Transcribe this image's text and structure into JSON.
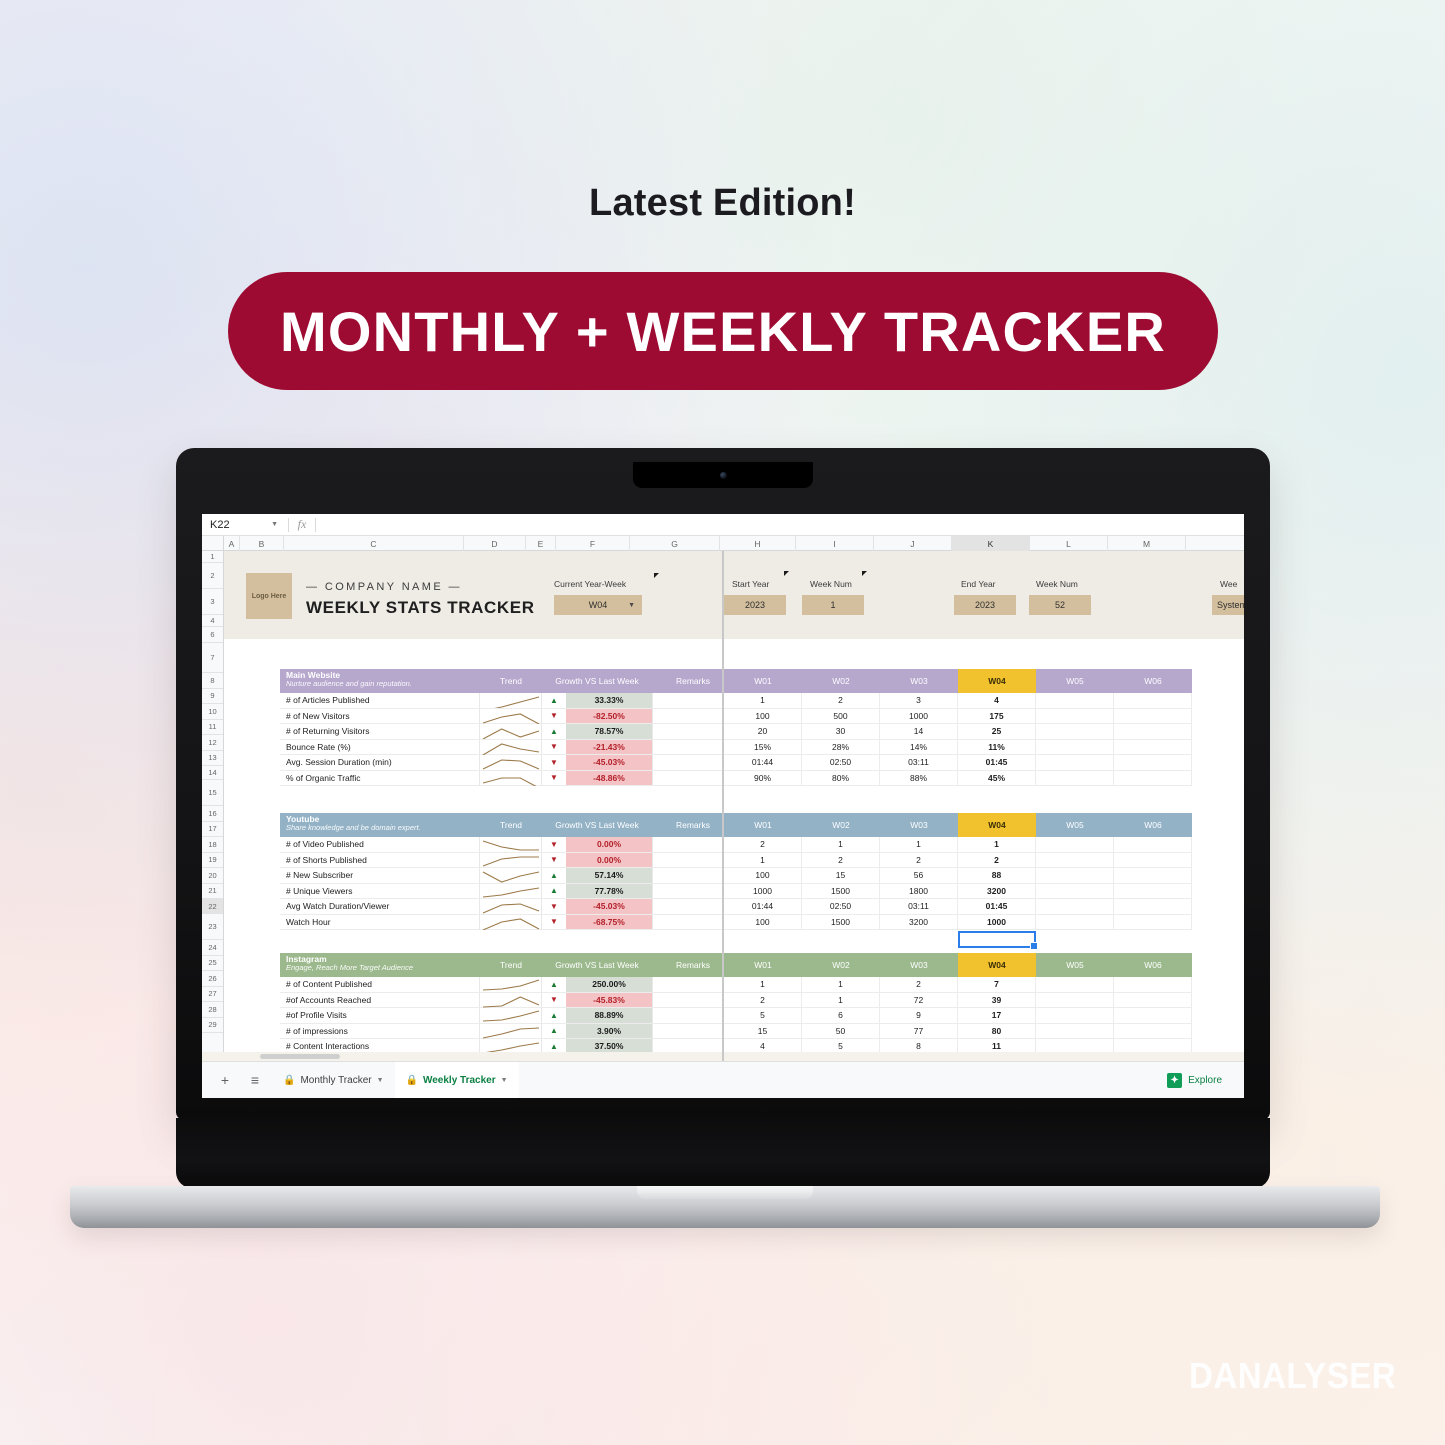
{
  "promo": {
    "eyebrow": "Latest Edition!",
    "pill_label": "MONTHLY + WEEKLY TRACKER",
    "pill_color": "#9e0b32",
    "watermark": "DANALYSER"
  },
  "spreadsheet": {
    "name_box": "K22",
    "fx_icon": "function-icon",
    "column_headers": [
      "A",
      "B",
      "C",
      "D",
      "E",
      "F",
      "G",
      "H",
      "I",
      "J",
      "K",
      "L",
      "M"
    ],
    "selected_column": "K",
    "row_headers": [
      "1",
      "2",
      "3",
      "4",
      "6",
      "7",
      "8",
      "9",
      "10",
      "11",
      "12",
      "13",
      "14",
      "15",
      "16",
      "17",
      "18",
      "19",
      "20",
      "21",
      "22",
      "23",
      "24",
      "25",
      "26",
      "27",
      "28",
      "29"
    ],
    "selected_row": "22",
    "banner": {
      "logo_text": "Logo Here",
      "company_name": "— COMPANY NAME —",
      "title": "WEEKLY STATS TRACKER",
      "fields": [
        {
          "label": "Current Year-Week",
          "value": "W04",
          "dropdown": true
        },
        {
          "label": "Start Year",
          "value": "2023",
          "dropdown": false
        },
        {
          "label": "Week Num",
          "value": "1",
          "dropdown": false
        },
        {
          "label": "End Year",
          "value": "2023",
          "dropdown": false
        },
        {
          "label": "Week Num",
          "value": "52",
          "dropdown": false
        },
        {
          "label": "Wee",
          "value": "System",
          "dropdown": false
        }
      ]
    },
    "table_headers": {
      "trend": "Trend",
      "growth": "Growth VS Last Week",
      "remarks": "Remarks"
    },
    "week_columns": [
      "W01",
      "W02",
      "W03",
      "W04",
      "W05",
      "W06"
    ],
    "current_week": "W04",
    "current_week_color": "#f2c12e",
    "sections": [
      {
        "id": "main-website",
        "icon": "website-icon",
        "name": "Main Website",
        "tagline": "Nurture audience and gain reputation.",
        "color": "#b6a7cd",
        "rows": [
          {
            "metric": "# of Articles Published",
            "direction": "up",
            "growth": "33.33%",
            "weeks": [
              "1",
              "2",
              "3",
              "4",
              "",
              ""
            ],
            "trend": [
              18,
              14,
              9,
              4
            ]
          },
          {
            "metric": "# of New Visitors",
            "direction": "down",
            "growth": "-82.50%",
            "weeks": [
              "100",
              "500",
              "1000",
              "175",
              "",
              ""
            ],
            "trend": [
              14,
              8,
              5,
              15
            ]
          },
          {
            "metric": "# of Returning Visitors",
            "direction": "up",
            "growth": "78.57%",
            "weeks": [
              "20",
              "30",
              "14",
              "25",
              "",
              ""
            ],
            "trend": [
              15,
              5,
              13,
              7
            ]
          },
          {
            "metric": "Bounce Rate (%)",
            "direction": "down",
            "growth": "-21.43%",
            "weeks": [
              "15%",
              "28%",
              "14%",
              "11%",
              "",
              ""
            ],
            "trend": [
              15,
              4,
              9,
              12
            ]
          },
          {
            "metric": "Avg. Session Duration (min)",
            "direction": "down",
            "growth": "-45.03%",
            "weeks": [
              "01:44",
              "02:50",
              "03:11",
              "01:45",
              "",
              ""
            ],
            "trend": [
              14,
              5,
              6,
              14
            ]
          },
          {
            "metric": "% of Organic Traffic",
            "direction": "down",
            "growth": "-48.86%",
            "weeks": [
              "90%",
              "80%",
              "88%",
              "45%",
              "",
              ""
            ],
            "trend": [
              12,
              7,
              7,
              17
            ]
          }
        ]
      },
      {
        "id": "youtube",
        "icon": "youtube-icon",
        "name": "Youtube",
        "tagline": "Share knowledge and be domain expert.",
        "color": "#93b2c6",
        "rows": [
          {
            "metric": "# of Video Published",
            "direction": "down",
            "growth": "0.00%",
            "weeks": [
              "2",
              "1",
              "1",
              "1",
              "",
              ""
            ],
            "trend": [
              4,
              10,
              13,
              13
            ]
          },
          {
            "metric": "# of Shorts Published",
            "direction": "down",
            "growth": "0.00%",
            "weeks": [
              "1",
              "2",
              "2",
              "2",
              "",
              ""
            ],
            "trend": [
              13,
              6,
              4,
              4
            ]
          },
          {
            "metric": "# New Subscriber",
            "direction": "up",
            "growth": "57.14%",
            "weeks": [
              "100",
              "15",
              "56",
              "88",
              "",
              ""
            ],
            "trend": [
              4,
              14,
              8,
              4
            ]
          },
          {
            "metric": "# Unique Viewers",
            "direction": "up",
            "growth": "77.78%",
            "weeks": [
              "1000",
              "1500",
              "1800",
              "3200",
              "",
              ""
            ],
            "trend": [
              13,
              11,
              7,
              4
            ]
          },
          {
            "metric": "Avg Watch Duration/Viewer",
            "direction": "down",
            "growth": "-45.03%",
            "weeks": [
              "01:44",
              "02:50",
              "03:11",
              "01:45",
              "",
              ""
            ],
            "trend": [
              14,
              6,
              5,
              12
            ]
          },
          {
            "metric": "Watch Hour",
            "direction": "down",
            "growth": "-68.75%",
            "weeks": [
              "100",
              "1500",
              "3200",
              "1000",
              "",
              ""
            ],
            "trend": [
              15,
              7,
              4,
              14
            ]
          }
        ]
      },
      {
        "id": "instagram",
        "icon": "instagram-icon",
        "name": "Instagram",
        "tagline": "Engage, Reach More Target Audience",
        "color": "#9cb98d",
        "rows": [
          {
            "metric": "# of Content Published",
            "direction": "up",
            "growth": "250.00%",
            "weeks": [
              "1",
              "1",
              "2",
              "7",
              "",
              ""
            ],
            "trend": [
              13,
              12,
              9,
              3
            ]
          },
          {
            "metric": "#of Accounts Reached",
            "direction": "down",
            "growth": "-45.83%",
            "weeks": [
              "2",
              "1",
              "72",
              "39",
              "",
              ""
            ],
            "trend": [
              14,
              13,
              4,
              12
            ]
          },
          {
            "metric": "#of Profile Visits",
            "direction": "up",
            "growth": "88.89%",
            "weeks": [
              "5",
              "6",
              "9",
              "17",
              "",
              ""
            ],
            "trend": [
              13,
              12,
              8,
              3
            ]
          },
          {
            "metric": "# of impressions",
            "direction": "up",
            "growth": "3.90%",
            "weeks": [
              "15",
              "50",
              "77",
              "80",
              "",
              ""
            ],
            "trend": [
              14,
              10,
              5,
              4
            ]
          },
          {
            "metric": "# Content Interactions",
            "direction": "up",
            "growth": "37.50%",
            "weeks": [
              "4",
              "5",
              "8",
              "11",
              "",
              ""
            ],
            "trend": [
              14,
              11,
              7,
              4
            ]
          }
        ]
      }
    ],
    "sheet_tabs": [
      {
        "label": "Monthly Tracker",
        "locked": true,
        "active": false
      },
      {
        "label": "Weekly Tracker",
        "locked": true,
        "active": true
      }
    ],
    "add_sheet_label": "+",
    "all_sheets_label": "≡",
    "explore_label": "Explore"
  }
}
